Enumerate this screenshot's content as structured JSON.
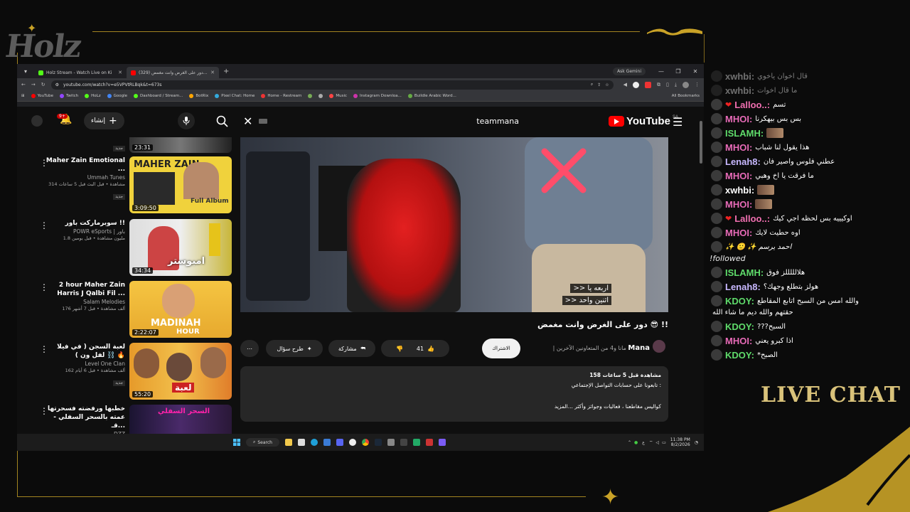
{
  "overlay": {
    "logo": "Holz",
    "live_chat_label": "LIVE CHAT",
    "accent_color": "#c9a227"
  },
  "browser": {
    "tabs": [
      {
        "title": "Holz Stream - Watch Live on Ki"
      },
      {
        "title": "(329) دور على الغرض وانت مغمض..."
      }
    ],
    "gemini_label": "Ask Gemini",
    "url": "youtube.com/watch?v=e5VPVtRLBqk&t=673s",
    "bookmarks": [
      "YouTube",
      "Twitch",
      "HoLz",
      "Google",
      "Dashboard / Stream...",
      "BotRix",
      "Pixel Chat: Home",
      "Home - Restream",
      "",
      "",
      "Music",
      "Instagram Downloa...",
      "Buildle Arabic Word..."
    ],
    "all_bookmarks": "All Bookmarks"
  },
  "youtube": {
    "logo_text": "YouTube",
    "region": "SA",
    "search_query": "teammana",
    "create_label": "إنشاء",
    "notification_count": "9+",
    "video_title": "دور على الغرض وانت مغمض 😎 !!",
    "subtitle_line_1": ">> اربعه يا",
    "subtitle_line_2": ">> اثنين واحد",
    "channel_name": "Mana",
    "channel_suffix": "| مانا و4 من المتعاونين الآخرين",
    "subscribe_label": "الاشتراك",
    "like_count": "41",
    "share_label": "مشاركة",
    "ask_label": "طرح سؤال",
    "description": {
      "stats": "158 مشاهدة  قبل 5 ساعات",
      "line1": "تابعونا على حسابات التواصل الإجتماعي :",
      "line2": "كواليس مقاطعنا ، فعاليات وجوائز وأكثر ...المزيد"
    },
    "sidebar": [
      {
        "duration": "23:31",
        "title": "",
        "channel": "",
        "meta": "",
        "badge": "جديد"
      },
      {
        "duration": "3:09:50",
        "title": "Maher Zain Emotional ...",
        "channel": "Ummah Tunes",
        "meta": "314 مشاهدة • قبل البث قبل 5 ساعات",
        "badge": "جديد",
        "thumb_text": "MAHER ZAIN",
        "thumb_sub": "Full Album"
      },
      {
        "duration": "34:34",
        "title": "سوبرماركت باور !!",
        "channel": "POWR eSports | باور",
        "meta": "1.8 مليون مشاهدة • قبل يومين",
        "badge": "",
        "thumb_text": "امبوستر"
      },
      {
        "duration": "2:22:07",
        "title": "2 hour Maher Zain Harris J  Qalbi Fil ...",
        "channel": "Salam Melodies",
        "meta": "176 ألف مشاهدة • قبل 7 أشهر",
        "badge": "",
        "thumb_text": "MADINAH",
        "thumb_sub": "HOUR"
      },
      {
        "duration": "55:20",
        "title": "لعبة السجن ( في فيلا لفل ون ) ⛓️ 🔥",
        "channel": "Level One Clan",
        "meta": "162 ألف مشاهدة • قبل 6 أيام",
        "badge": "جديد",
        "thumb_text": "لعبة"
      },
      {
        "duration": "",
        "title": "خطبها ورفضته فسحرتها عمته بالسحر السفلي - قـ...",
        "channel": "DZZ",
        "meta": "",
        "badge": "",
        "thumb_text": "السحر السفلي"
      }
    ]
  },
  "taskbar": {
    "search_label": "Search",
    "time": "11:38 PM",
    "date": "8/2/2026",
    "lang": "ع"
  },
  "chat": [
    {
      "user": "xwhbi:",
      "text": "قال اخوان ياخوي",
      "color": "#e8e8e8",
      "dim": true
    },
    {
      "user": "xwhbi:",
      "text": "ما قال اخوات",
      "color": "#e8e8e8",
      "dim": true
    },
    {
      "user": "Lalloo..:",
      "text": "تسم",
      "color": "#f06fb0",
      "heart": true
    },
    {
      "user": "MHOI:",
      "text": "بس بس بيهكرنا",
      "color": "#e86bb8"
    },
    {
      "user": "ISLAMH:",
      "text": "",
      "color": "#5fdc6b",
      "emote": true
    },
    {
      "user": "MHOI:",
      "text": "هذا يقول لنا شباب",
      "color": "#e86bb8"
    },
    {
      "user": "Lenah8:",
      "text": "عطني فلوس واصير فان",
      "color": "#c8b8ff"
    },
    {
      "user": "MHOI:",
      "text": "ما فرقت يا اخ وهبي",
      "color": "#e86bb8"
    },
    {
      "user": "xwhbi:",
      "text": "",
      "color": "#ffffff",
      "emote": true
    },
    {
      "user": "MHOI:",
      "text": "",
      "color": "#e86bb8",
      "emote": true
    },
    {
      "user": "Lalloo..:",
      "text": "اوكيييه بس لحظه اجي كيك",
      "color": "#f06fb0",
      "heart": true
    },
    {
      "user": "MHOI:",
      "text": "اوه حطيت لايك",
      "color": "#e86bb8"
    },
    {
      "user": "احمد يرسم",
      "text": "احمد يرسم ✨ 🙂 ✨",
      "color": "#ffffff",
      "followed": "!followed"
    },
    {
      "user": "ISLAMH:",
      "text": "هلالللللز فوق",
      "color": "#5fdc6b"
    },
    {
      "user": "Lenah8:",
      "text": "هولز بتطلع وجهك؟",
      "color": "#c8b8ff"
    },
    {
      "user": "KDOY:",
      "text": "والله امس من السبح اتابع المقاطع",
      "color": "#5fdc6b",
      "cont": "حقتهم والله ديم ما شاء الله"
    },
    {
      "user": "KDOY:",
      "text": "السبح???",
      "color": "#5fdc6b"
    },
    {
      "user": "MHOI:",
      "text": "اذا كبرو يعني",
      "color": "#e86bb8"
    },
    {
      "user": "KDOY:",
      "text": "الصبح*",
      "color": "#5fdc6b"
    }
  ]
}
